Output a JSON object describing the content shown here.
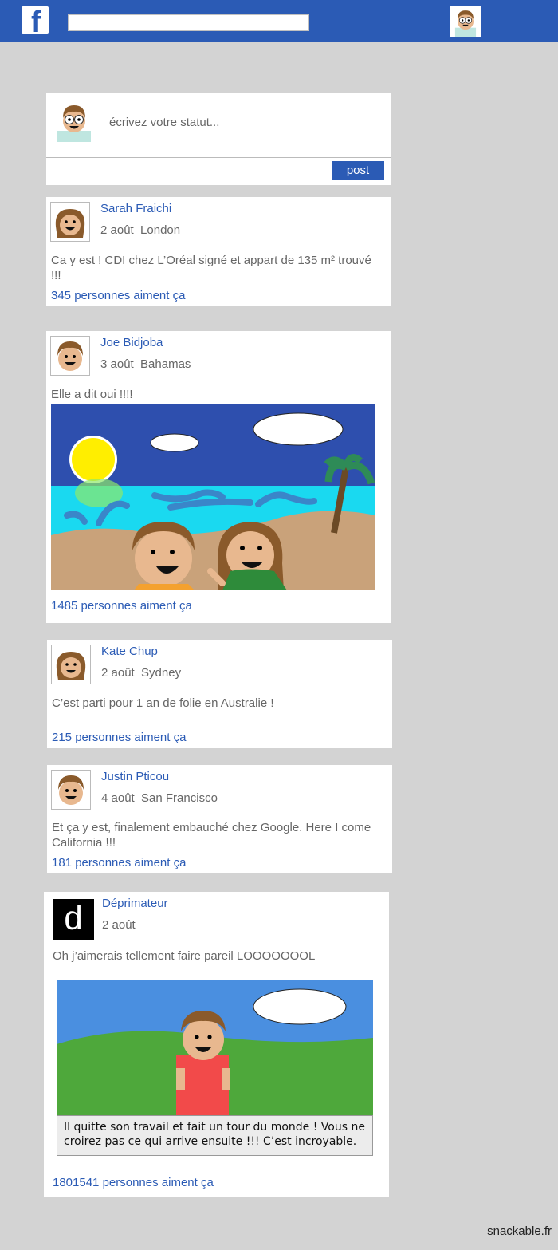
{
  "topbar": {
    "logo_letter": "f",
    "search_value": ""
  },
  "composer": {
    "placeholder": "écrivez votre statut...",
    "post_label": "post"
  },
  "posts": [
    {
      "name": "Sarah Fraichi",
      "meta": "2 août  London",
      "text": "Ca y est ! CDI chez L’Oréal signé et appart de 135 m² trouvé !!!",
      "likes": "345 personnes aiment ça"
    },
    {
      "name": "Joe Bidjoba",
      "meta": "3 août  Bahamas",
      "text": "Elle a dit oui !!!!",
      "likes": "1485 personnes aiment ça"
    },
    {
      "name": "Kate Chup",
      "meta": "2 août  Sydney",
      "text": "C’est parti pour 1 an de folie en Australie !",
      "likes": "215 personnes aiment ça"
    },
    {
      "name": "Justin Pticou",
      "meta": "4 août  San Francisco",
      "text": "Et ça y est, finalement embauché chez Google. Here I come California !!!",
      "likes": "181 personnes aiment ça"
    },
    {
      "name": "Déprimateur",
      "avatar_letter": "d",
      "meta": "2 août",
      "text": "Oh j’aimerais tellement faire pareil LOOOOOOOL",
      "caption": "Il quitte son travail et fait un tour du monde ! Vous ne croirez pas ce qui arrive ensuite !!! C’est incroyable.",
      "likes": "1801541 personnes aiment ça"
    }
  ],
  "footer": {
    "brand": "snackable.fr"
  }
}
